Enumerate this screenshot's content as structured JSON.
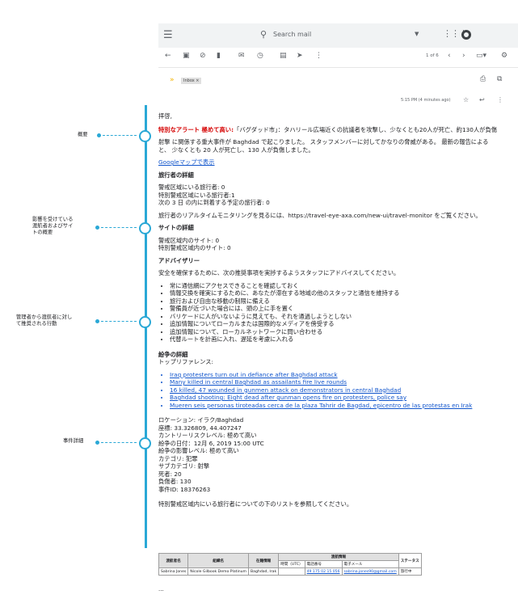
{
  "gmail": {
    "search_placeholder": "Search mail",
    "pagination": "1 of 6",
    "label_chip": "Inbox ×",
    "timestamp": "5:15 PM (4 minutes ago)"
  },
  "callouts": {
    "overview": "概要",
    "impacted": [
      "影響を受けている",
      "渡航者およびサイ",
      "トの概要"
    ],
    "recommended": [
      "管理者から渡航者に対し",
      "て推奨される行動"
    ],
    "incident": "事件詳細"
  },
  "email": {
    "greeting": "拝啓,",
    "alert_prefix": "特別なアラート 極めて高い:",
    "alert_text": "「バグダッド市」：タハリール広場近くの抗議者を攻撃し、少なくとも20人が死亡、約130人が負傷",
    "summary": "射撃 に関係する重大事件が Baghdad で起こりました。 スタッフメンバーに対してかなりの脅威がある。 最新の報告によると、 少なくとも 20 人が死亡し、130 人が負傷しました。",
    "map_link": "Googleマップで表示",
    "travelers_title": "旅行者の詳細",
    "travelers": [
      "警戒区域にいる旅行者: 0",
      "特別警戒区域にいる旅行者:1",
      "次の 3 日 の内に到着する予定の旅行者: 0"
    ],
    "monitor_text": "旅行者のリアルタイムモニタリングを見るには、https://travel-eye-axa.com/new-ui/travel-monitor をご覧ください。",
    "sites_title": "サイトの詳細",
    "sites": [
      "警戒区域内のサイト: 0",
      "特別警戒区域内のサイト: 0"
    ],
    "advisory_title": "アドバイザリー",
    "advisory_intro": "安全を確保するために、次の推奨事項を実捗するようスタッフにアドバイスしてください。",
    "advisory": [
      "常に通信網にアクセスできることを確認しておく",
      "情報交換を確実にするために、あなたが滞在する地域の他のスタッフと通信を維持する",
      "旅行および自由な移動の制限に備える",
      "警備員が近づいた場合には、頭の上に手を置く",
      "バリケードに人がいないように見えても、それを通過しようとしない",
      "追加情報についてローカルまたは国際的なメディアを傍受する",
      "追加情報について、ローカルネットワークに問い合わせる",
      "代替ルートを計画に入れ、遅延を考慮に入れる"
    ],
    "incident_title": "紛争の詳細",
    "refs_title": "トップリファレンス:",
    "refs": [
      "Iraq protesters turn out in defiance after Baghdad attack",
      "Many killed in central Baghdad as assailants fire live rounds",
      "16 killed, 47 wounded in gunmen attack on demonstrators in central Baghdad",
      "Baghdad shooting: Eight dead after gunman opens fire on protesters, police say",
      "Mueren seis personas tiroteadas cerca de la plaza Tahrir de Bagdad, epicentro de las protestas en Irak"
    ],
    "details": [
      "ロケーション: イラク/Baghdad",
      "座標: 33.326809, 44.407247",
      "カントリーリスクレベル: 極めて高い",
      "紛争の日付：12月 6, 2019 15:00 UTC",
      "紛争の影響レベル: 極めて高い",
      "カテゴリ: 犯罪",
      "サブカテゴリ: 射撃",
      "死者: 20",
      "負傷者: 130",
      "事件ID: 18376263"
    ],
    "list_note": "特別警戒区域内にいる旅行者についての下のリストを参照してください。",
    "ellipsis": "..."
  },
  "table": {
    "headers": [
      "渡航者名",
      "組織名",
      "在籍情報",
      "渡航情報",
      "ステータス"
    ],
    "subheaders": [
      "時間（UTC）",
      "電話番号",
      "電子メール"
    ],
    "row": [
      "Sabrina Jones",
      "Nicole Gilbook Demo Platinum",
      "Baghdad, Irak",
      "",
      "49 175 02 15 056",
      "sabrina.jones90@gmail.com",
      "旅行中"
    ]
  },
  "colors": {
    "accent": "#2aa8d6",
    "alert": "#d50000",
    "link": "#1155cc"
  }
}
